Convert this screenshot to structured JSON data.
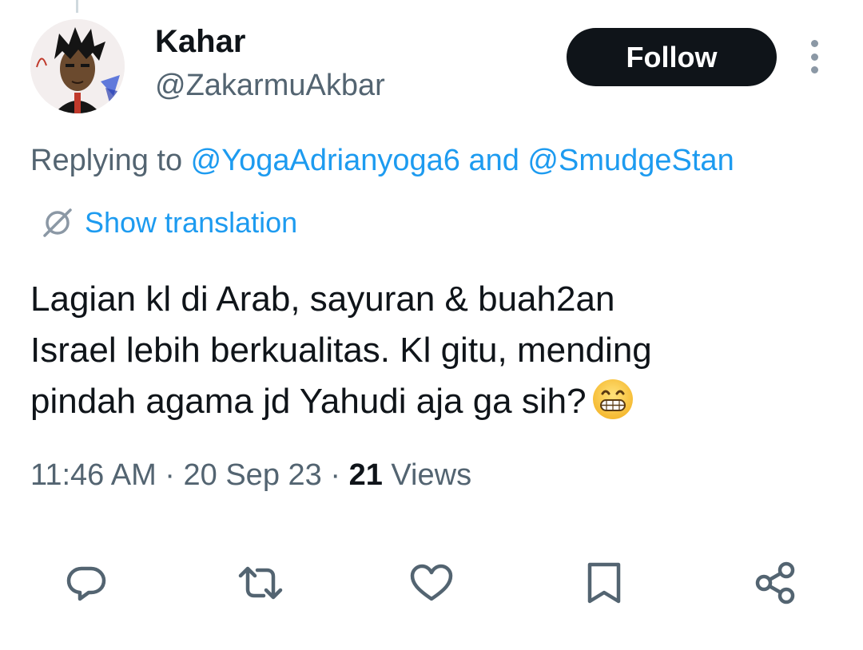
{
  "author": {
    "name": "Kahar",
    "handle": "@ZakarmuAkbar"
  },
  "follow_button": {
    "label": "Follow"
  },
  "reply_context": {
    "prefix": "Replying to ",
    "mention_1": "@YogaAdrianyoga6",
    "joiner": " and ",
    "mention_2": "@SmudgeStan"
  },
  "translation": {
    "label": "Show translation",
    "icon": "translate-icon"
  },
  "tweet": {
    "lines": [
      "Lagian kl di Arab, sayuran & buah2an",
      "Israel lebih berkualitas. Kl gitu, mending",
      "pindah agama jd Yahudi aja ga sih?"
    ],
    "emoji": "grinning-face-emoji"
  },
  "meta": {
    "time": "11:46 AM",
    "separator": " · ",
    "date": "20 Sep 23",
    "views_count": "21",
    "views_label": " Views"
  },
  "actions": [
    {
      "name": "reply",
      "icon": "reply-icon"
    },
    {
      "name": "retweet",
      "icon": "retweet-icon"
    },
    {
      "name": "like",
      "icon": "heart-icon"
    },
    {
      "name": "bookmark",
      "icon": "bookmark-icon"
    },
    {
      "name": "share",
      "icon": "share-icon"
    }
  ],
  "colors": {
    "primary_text": "#0f1419",
    "secondary_text": "#536471",
    "link": "#1d9bf0",
    "icon_gray": "#536471"
  }
}
